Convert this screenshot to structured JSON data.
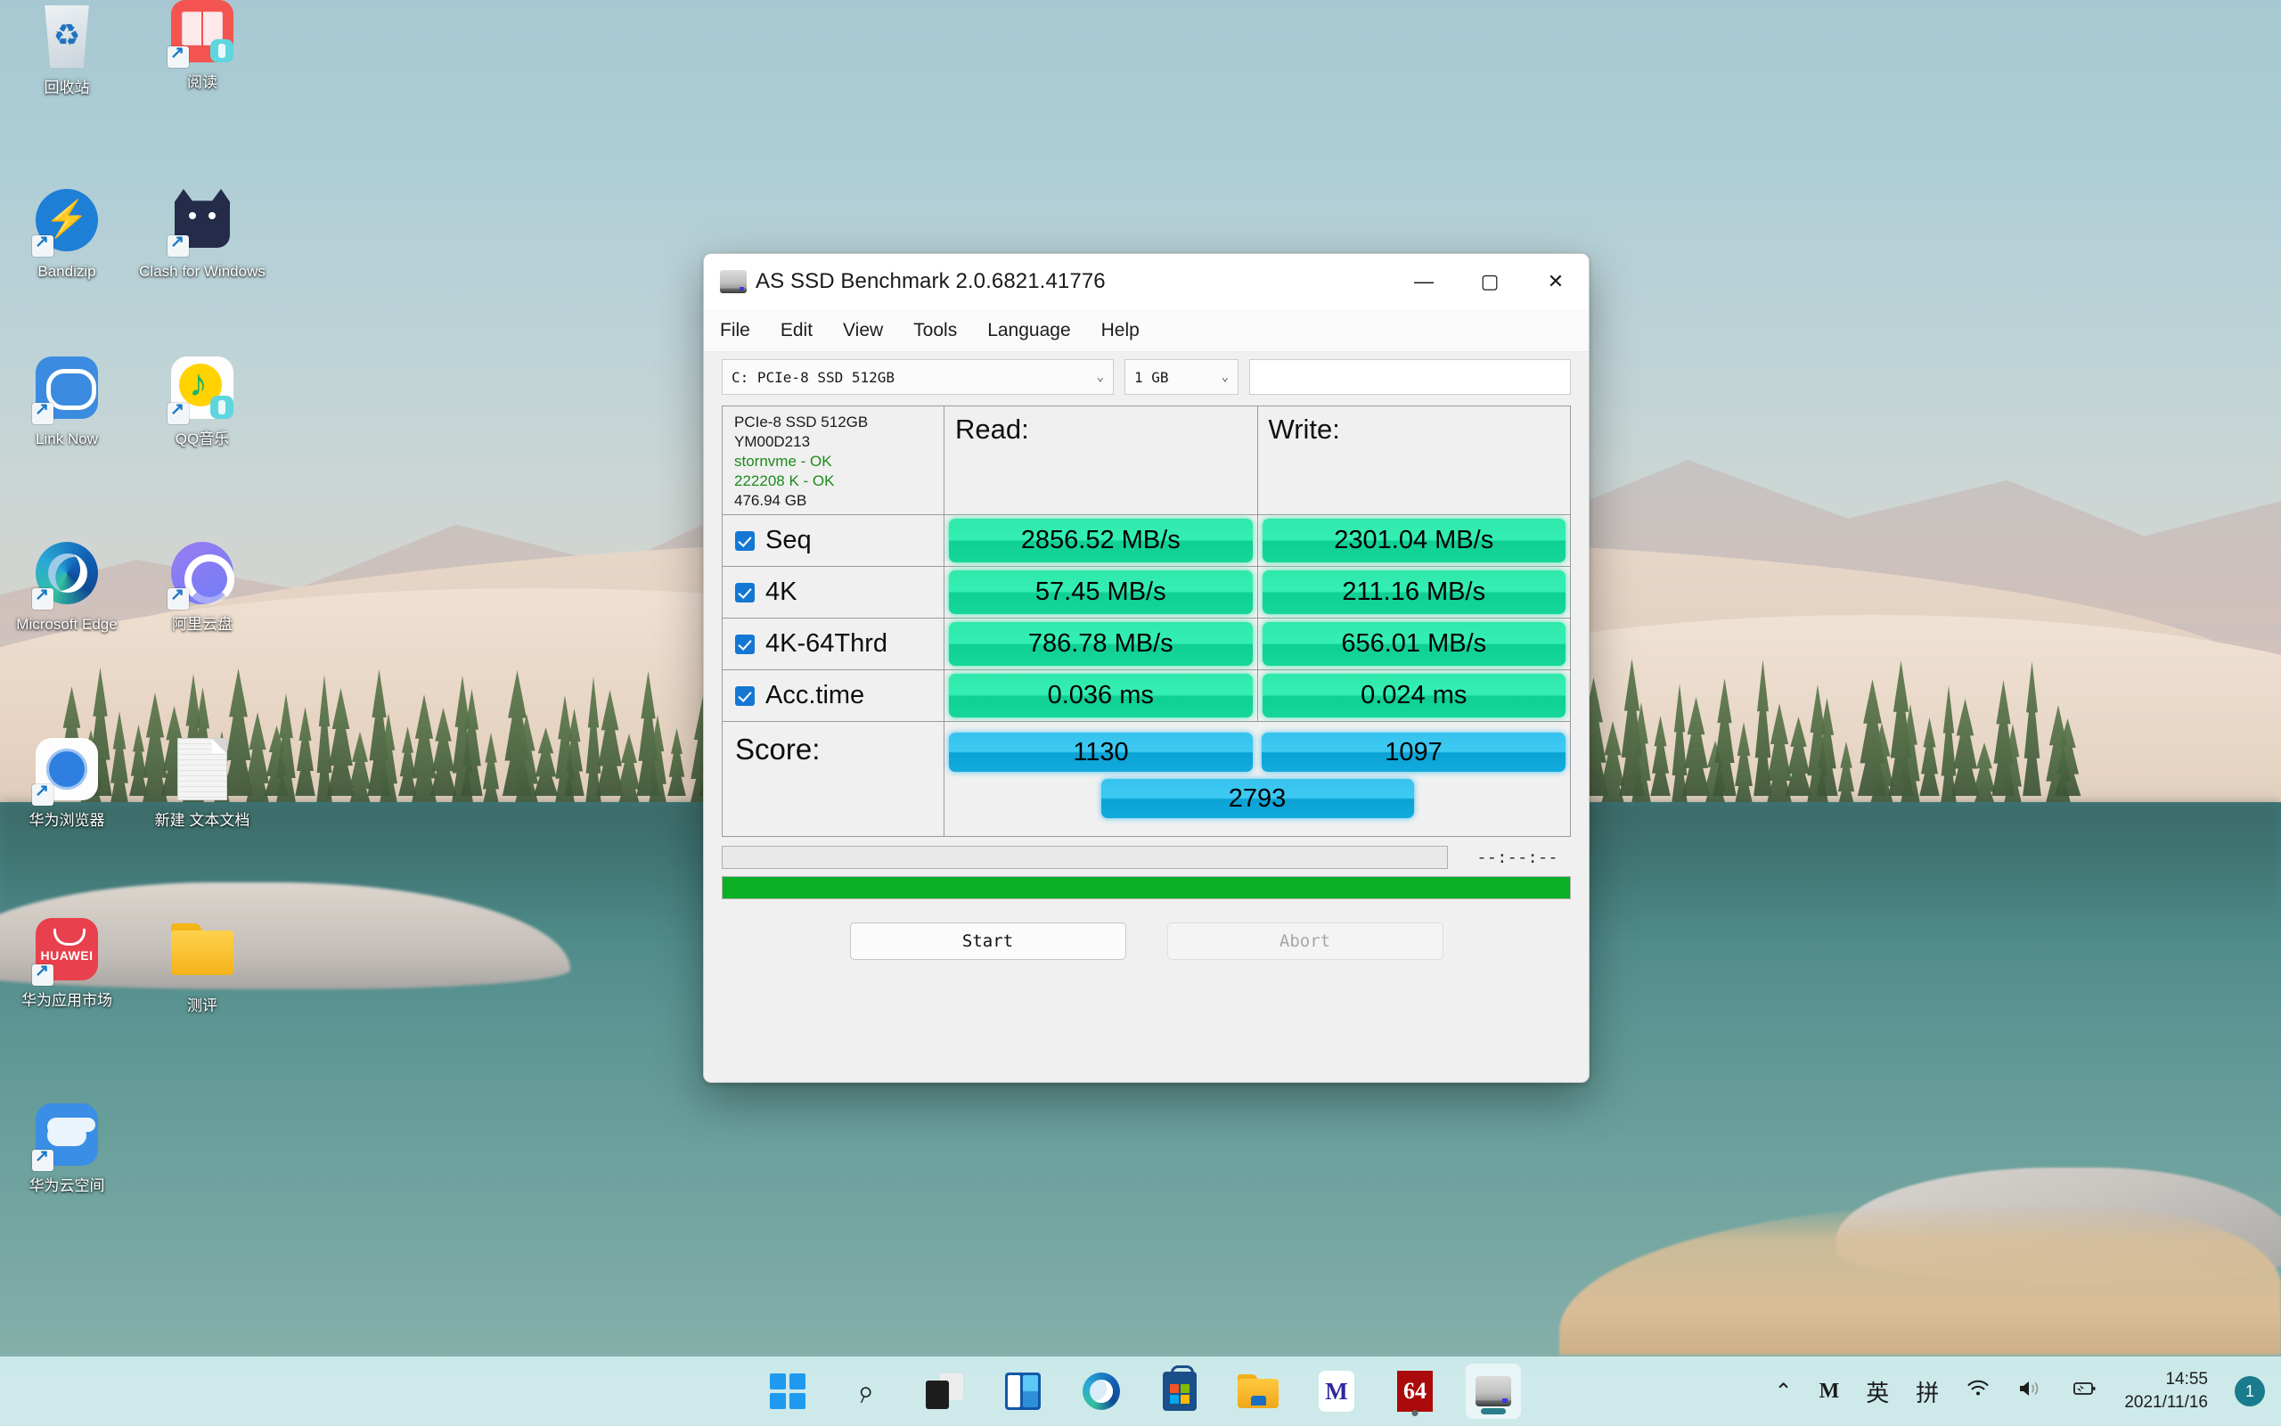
{
  "desktop": {
    "icons": [
      {
        "label": "回收站",
        "icon": "recycle-bin-icon"
      },
      {
        "label": "阅读",
        "icon": "reader-app-icon"
      },
      {
        "label": "Bandizip",
        "icon": "bandizip-icon"
      },
      {
        "label": "Clash for Windows",
        "icon": "clash-for-windows-icon"
      },
      {
        "label": "Link Now",
        "icon": "link-now-icon"
      },
      {
        "label": "QQ音乐",
        "icon": "qq-music-icon"
      },
      {
        "label": "Microsoft Edge",
        "icon": "microsoft-edge-icon"
      },
      {
        "label": "阿里云盘",
        "icon": "aliyun-drive-icon"
      },
      {
        "label": "华为浏览器",
        "icon": "huawei-browser-icon"
      },
      {
        "label": "新建 文本文档",
        "icon": "text-document-icon"
      },
      {
        "label": "华为应用市场",
        "icon": "huawei-appgallery-icon"
      },
      {
        "label": "测评",
        "icon": "folder-icon"
      },
      {
        "label": "华为云空间",
        "icon": "huawei-cloud-icon"
      }
    ],
    "huawei_wordmark": "HUAWEI"
  },
  "window": {
    "title": "AS SSD Benchmark 2.0.6821.41776",
    "controls": {
      "minimize": "—",
      "maximize": "▢",
      "close": "✕"
    },
    "menu": [
      "File",
      "Edit",
      "View",
      "Tools",
      "Language",
      "Help"
    ],
    "toolbar": {
      "drive_selected": "C: PCIe-8 SSD 512GB",
      "size_selected": "1 GB",
      "status_field_value": "",
      "caret": "⌄"
    },
    "drive_info": {
      "model": "PCIe-8 SSD 512GB",
      "firmware": "YM00D213",
      "driver_status": "stornvme - OK",
      "alignment_status": "222208 K - OK",
      "capacity": "476.94 GB"
    },
    "columns": {
      "read": "Read:",
      "write": "Write:"
    },
    "rows": [
      {
        "name": "Seq",
        "checked": true,
        "read": "2856.52 MB/s",
        "write": "2301.04 MB/s"
      },
      {
        "name": "4K",
        "checked": true,
        "read": "57.45 MB/s",
        "write": "211.16 MB/s"
      },
      {
        "name": "4K-64Thrd",
        "checked": true,
        "read": "786.78 MB/s",
        "write": "656.01 MB/s"
      },
      {
        "name": "Acc.time",
        "checked": true,
        "read": "0.036 ms",
        "write": "0.024 ms"
      }
    ],
    "score": {
      "label": "Score:",
      "read": "1130",
      "write": "1097",
      "total": "2793"
    },
    "progress": {
      "elapsed": "--:--:--",
      "percent": 100
    },
    "buttons": {
      "start": "Start",
      "abort": "Abort"
    },
    "colors": {
      "speed_pill": "#2fe8ab",
      "score_pill": "#35c2ee",
      "progress_green": "#0aaf24",
      "checkbox_blue": "#1477d4"
    }
  },
  "taskbar": {
    "items": [
      {
        "name": "start-button",
        "icon": "windows-logo-icon"
      },
      {
        "name": "search-button",
        "icon": "search-icon"
      },
      {
        "name": "task-view-button",
        "icon": "task-view-icon"
      },
      {
        "name": "widgets-button",
        "icon": "widgets-icon"
      },
      {
        "name": "edge-button",
        "icon": "microsoft-edge-icon"
      },
      {
        "name": "store-button",
        "icon": "microsoft-store-icon"
      },
      {
        "name": "file-explorer-button",
        "icon": "file-explorer-icon"
      },
      {
        "name": "im-button",
        "icon": "im-app-icon",
        "glyph": "M"
      },
      {
        "name": "cpuz64-button",
        "icon": "cpu-z-64-icon",
        "glyph": "64"
      },
      {
        "name": "asssd-button",
        "icon": "as-ssd-benchmark-icon",
        "active": true
      }
    ],
    "tray": {
      "overflow": "⌃",
      "im_icon": "M",
      "ime_lang": "英",
      "ime_mode": "拼",
      "wifi_icon": "wifi-icon",
      "volume_icon": "speaker-icon",
      "battery_icon": "battery-charging-icon",
      "time": "14:55",
      "date": "2021/11/16",
      "notification_count": "1"
    }
  }
}
